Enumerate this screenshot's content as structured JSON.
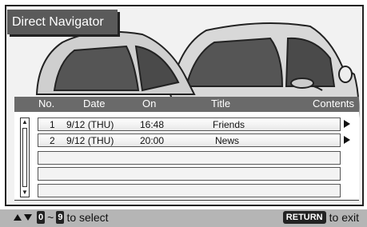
{
  "window": {
    "title": "Direct Navigator"
  },
  "columns": {
    "no": "No.",
    "date": "Date",
    "on": "On",
    "title": "Title",
    "contents": "Contents"
  },
  "rows": [
    {
      "no": "1",
      "date": "9/12 (THU)",
      "on": "16:48",
      "title": "Friends"
    },
    {
      "no": "2",
      "date": "9/12 (THU)",
      "on": "20:00",
      "title": "News"
    }
  ],
  "footer": {
    "key_zero": "0",
    "tilde": "~",
    "key_nine": "9",
    "select_text": "to select",
    "return_key": "RETURN",
    "exit_text": "to exit"
  },
  "colors": {
    "header_bg": "#6a6a6a",
    "title_bg": "#5a5a5a",
    "footer_bg": "#b5b5b5"
  },
  "icons": [
    "up-down-arrow-icon",
    "play-arrow-icon",
    "scroll-up-icon",
    "scroll-down-icon"
  ]
}
